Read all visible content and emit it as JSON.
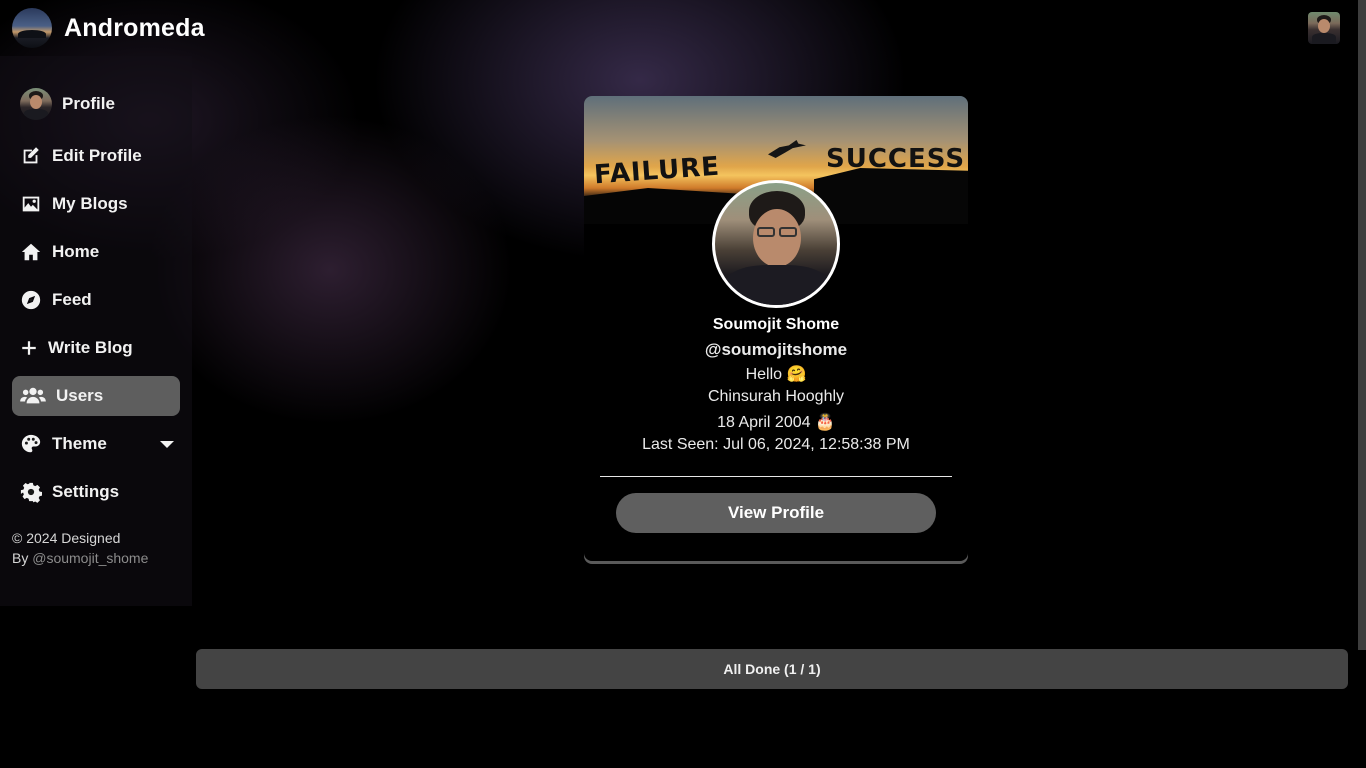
{
  "app": {
    "title": "Andromeda"
  },
  "sidebar": {
    "items": [
      {
        "label": "Profile",
        "icon": "avatar"
      },
      {
        "label": "Edit Profile",
        "icon": "edit-icon"
      },
      {
        "label": "My Blogs",
        "icon": "image-icon"
      },
      {
        "label": "Home",
        "icon": "home-icon"
      },
      {
        "label": "Feed",
        "icon": "compass-icon"
      },
      {
        "label": "Write Blog",
        "icon": "plus-icon"
      },
      {
        "label": "Users",
        "icon": "users-icon",
        "active": true
      },
      {
        "label": "Theme",
        "icon": "palette-icon"
      },
      {
        "label": "Settings",
        "icon": "gear-icon"
      }
    ],
    "copyright_line1": "© 2024 Designed",
    "copyright_by": "By",
    "copyright_handle": "@soumojit_shome"
  },
  "user_card": {
    "banner_left_word": "FAILURE",
    "banner_right_word": "SUCCESS",
    "name": "Soumojit Shome",
    "username": "@soumojitshome",
    "bio": "Hello 🤗",
    "location": "Chinsurah Hooghly",
    "birthday": "18 April 2004 🎂",
    "last_seen": "Last Seen: Jul 06, 2024, 12:58:38 PM",
    "view_button": "View Profile"
  },
  "status": {
    "all_done": "All Done (1 / 1)"
  },
  "colors": {
    "active_nav": "#5e5e5e",
    "button": "#5f5f5f",
    "status_bar": "#444444"
  }
}
